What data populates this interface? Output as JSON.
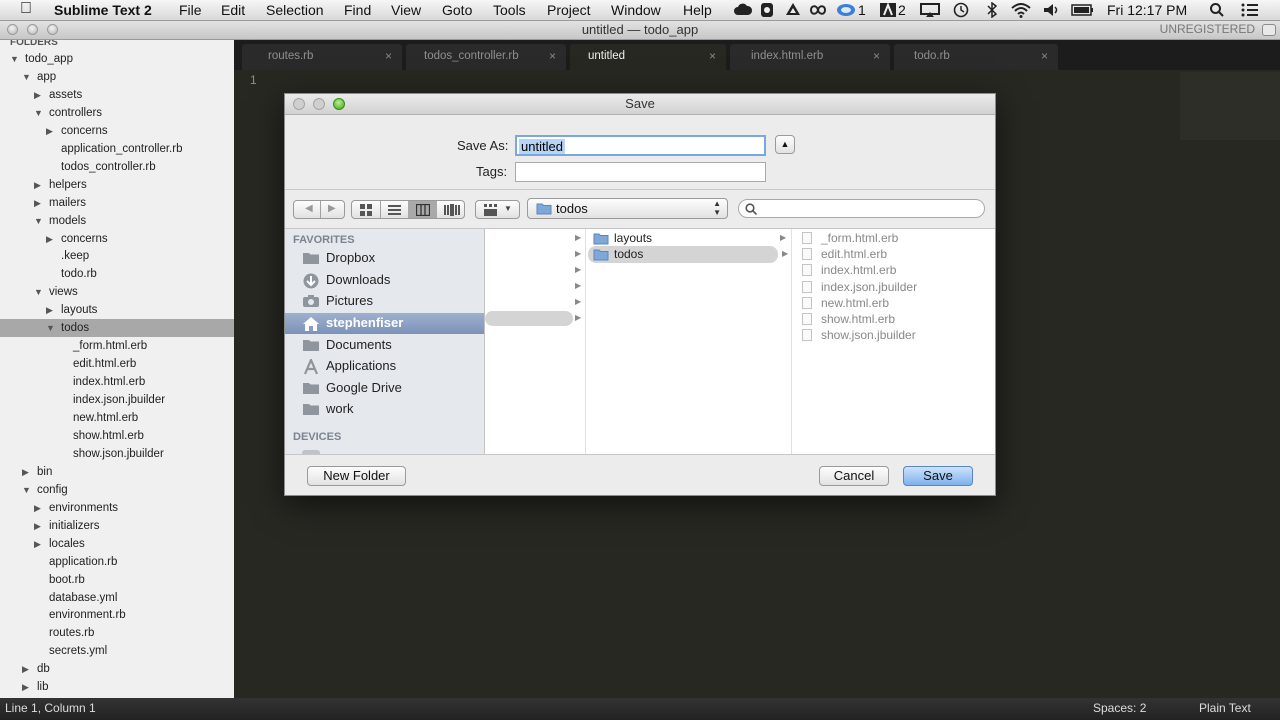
{
  "menubar": {
    "app_name": "Sublime Text 2",
    "items": [
      "File",
      "Edit",
      "Selection",
      "Find",
      "View",
      "Goto",
      "Tools",
      "Project",
      "Window",
      "Help"
    ],
    "status_badge_1": "1",
    "status_badge_2": "2",
    "clock": "Fri 12:17 PM"
  },
  "window": {
    "title": "untitled — todo_app",
    "unregistered": "UNREGISTERED"
  },
  "sidebar": {
    "header": "FOLDERS",
    "rows": [
      {
        "label": "todo_app",
        "arrow": "▼"
      },
      {
        "label": "app",
        "arrow": "▼"
      },
      {
        "label": "assets",
        "arrow": "▶"
      },
      {
        "label": "controllers",
        "arrow": "▼"
      },
      {
        "label": "concerns",
        "arrow": "▶"
      },
      {
        "label": "application_controller.rb",
        "arrow": ""
      },
      {
        "label": "todos_controller.rb",
        "arrow": ""
      },
      {
        "label": "helpers",
        "arrow": "▶"
      },
      {
        "label": "mailers",
        "arrow": "▶"
      },
      {
        "label": "models",
        "arrow": "▼"
      },
      {
        "label": "concerns",
        "arrow": "▶"
      },
      {
        "label": ".keep",
        "arrow": ""
      },
      {
        "label": "todo.rb",
        "arrow": ""
      },
      {
        "label": "views",
        "arrow": "▼"
      },
      {
        "label": "layouts",
        "arrow": "▶"
      },
      {
        "label": "todos",
        "arrow": "▼"
      },
      {
        "label": "_form.html.erb",
        "arrow": ""
      },
      {
        "label": "edit.html.erb",
        "arrow": ""
      },
      {
        "label": "index.html.erb",
        "arrow": ""
      },
      {
        "label": "index.json.jbuilder",
        "arrow": ""
      },
      {
        "label": "new.html.erb",
        "arrow": ""
      },
      {
        "label": "show.html.erb",
        "arrow": ""
      },
      {
        "label": "show.json.jbuilder",
        "arrow": ""
      },
      {
        "label": "bin",
        "arrow": "▶"
      },
      {
        "label": "config",
        "arrow": "▼"
      },
      {
        "label": "environments",
        "arrow": "▶"
      },
      {
        "label": "initializers",
        "arrow": "▶"
      },
      {
        "label": "locales",
        "arrow": "▶"
      },
      {
        "label": "application.rb",
        "arrow": ""
      },
      {
        "label": "boot.rb",
        "arrow": ""
      },
      {
        "label": "database.yml",
        "arrow": ""
      },
      {
        "label": "environment.rb",
        "arrow": ""
      },
      {
        "label": "routes.rb",
        "arrow": ""
      },
      {
        "label": "secrets.yml",
        "arrow": ""
      },
      {
        "label": "db",
        "arrow": "▶"
      },
      {
        "label": "lib",
        "arrow": "▶"
      }
    ]
  },
  "tabs": [
    {
      "label": "routes.rb",
      "close": "×"
    },
    {
      "label": "todos_controller.rb",
      "close": "×"
    },
    {
      "label": "untitled",
      "close": "×"
    },
    {
      "label": "index.html.erb",
      "close": "×"
    },
    {
      "label": "todo.rb",
      "close": "×"
    }
  ],
  "editor": {
    "line_number": "1"
  },
  "statusbar": {
    "position": "Line 1, Column 1",
    "spaces": "Spaces: 2",
    "syntax": "Plain Text"
  },
  "dialog": {
    "title": "Save",
    "save_as_label": "Save As:",
    "save_as_value": "untitled",
    "tags_label": "Tags:",
    "tags_value": "",
    "location": "todos",
    "search_value": "",
    "favorites_header": "FAVORITES",
    "favorites": [
      {
        "label": "Dropbox",
        "icon": "folder-icon"
      },
      {
        "label": "Downloads",
        "icon": "downloads-icon"
      },
      {
        "label": "Pictures",
        "icon": "camera-icon"
      },
      {
        "label": "stephenfiser",
        "icon": "home-icon"
      },
      {
        "label": "Documents",
        "icon": "folder-icon"
      },
      {
        "label": "Applications",
        "icon": "applications-icon"
      },
      {
        "label": "Google Drive",
        "icon": "folder-icon"
      },
      {
        "label": "work",
        "icon": "folder-icon"
      }
    ],
    "devices_header": "DEVICES",
    "column2": [
      {
        "label": "layouts"
      },
      {
        "label": "todos"
      }
    ],
    "column3": [
      {
        "label": "_form.html.erb"
      },
      {
        "label": "edit.html.erb"
      },
      {
        "label": "index.html.erb"
      },
      {
        "label": "index.json.jbuilder"
      },
      {
        "label": "new.html.erb"
      },
      {
        "label": "show.html.erb"
      },
      {
        "label": "show.json.jbuilder"
      }
    ],
    "new_folder": "New Folder",
    "cancel": "Cancel",
    "save": "Save"
  }
}
